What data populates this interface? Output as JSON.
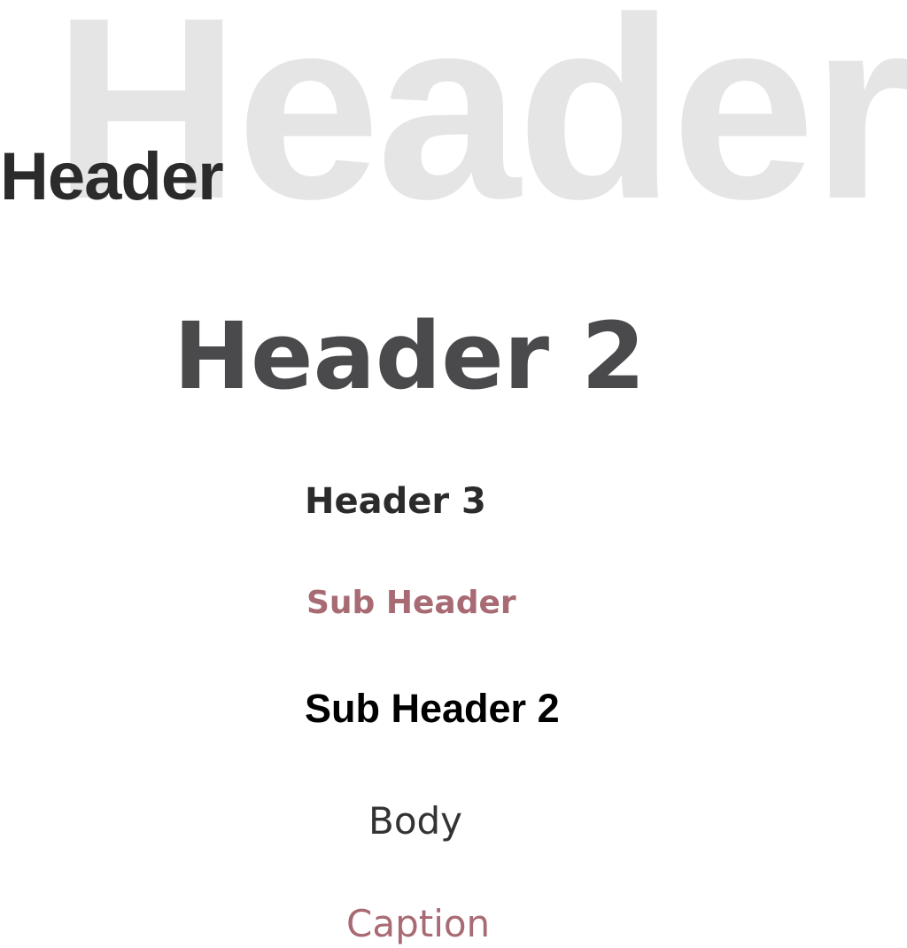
{
  "typography": {
    "header_watermark": {
      "text": "Header",
      "color": "#e5e5e5"
    },
    "header_1": {
      "text": "Header",
      "color": "#2b2b2b"
    },
    "header_2": {
      "text": "Header 2",
      "color": "#4a4a4c"
    },
    "header_3": {
      "text": "Header 3",
      "color": "#2b2b2b"
    },
    "sub_header": {
      "text": "Sub Header",
      "color": "#a86b74"
    },
    "sub_header_2": {
      "text": "Sub Header 2",
      "color": "#000000"
    },
    "body": {
      "text": "Body",
      "color": "#333333"
    },
    "caption": {
      "text": "Caption",
      "color": "#a86b74"
    }
  }
}
